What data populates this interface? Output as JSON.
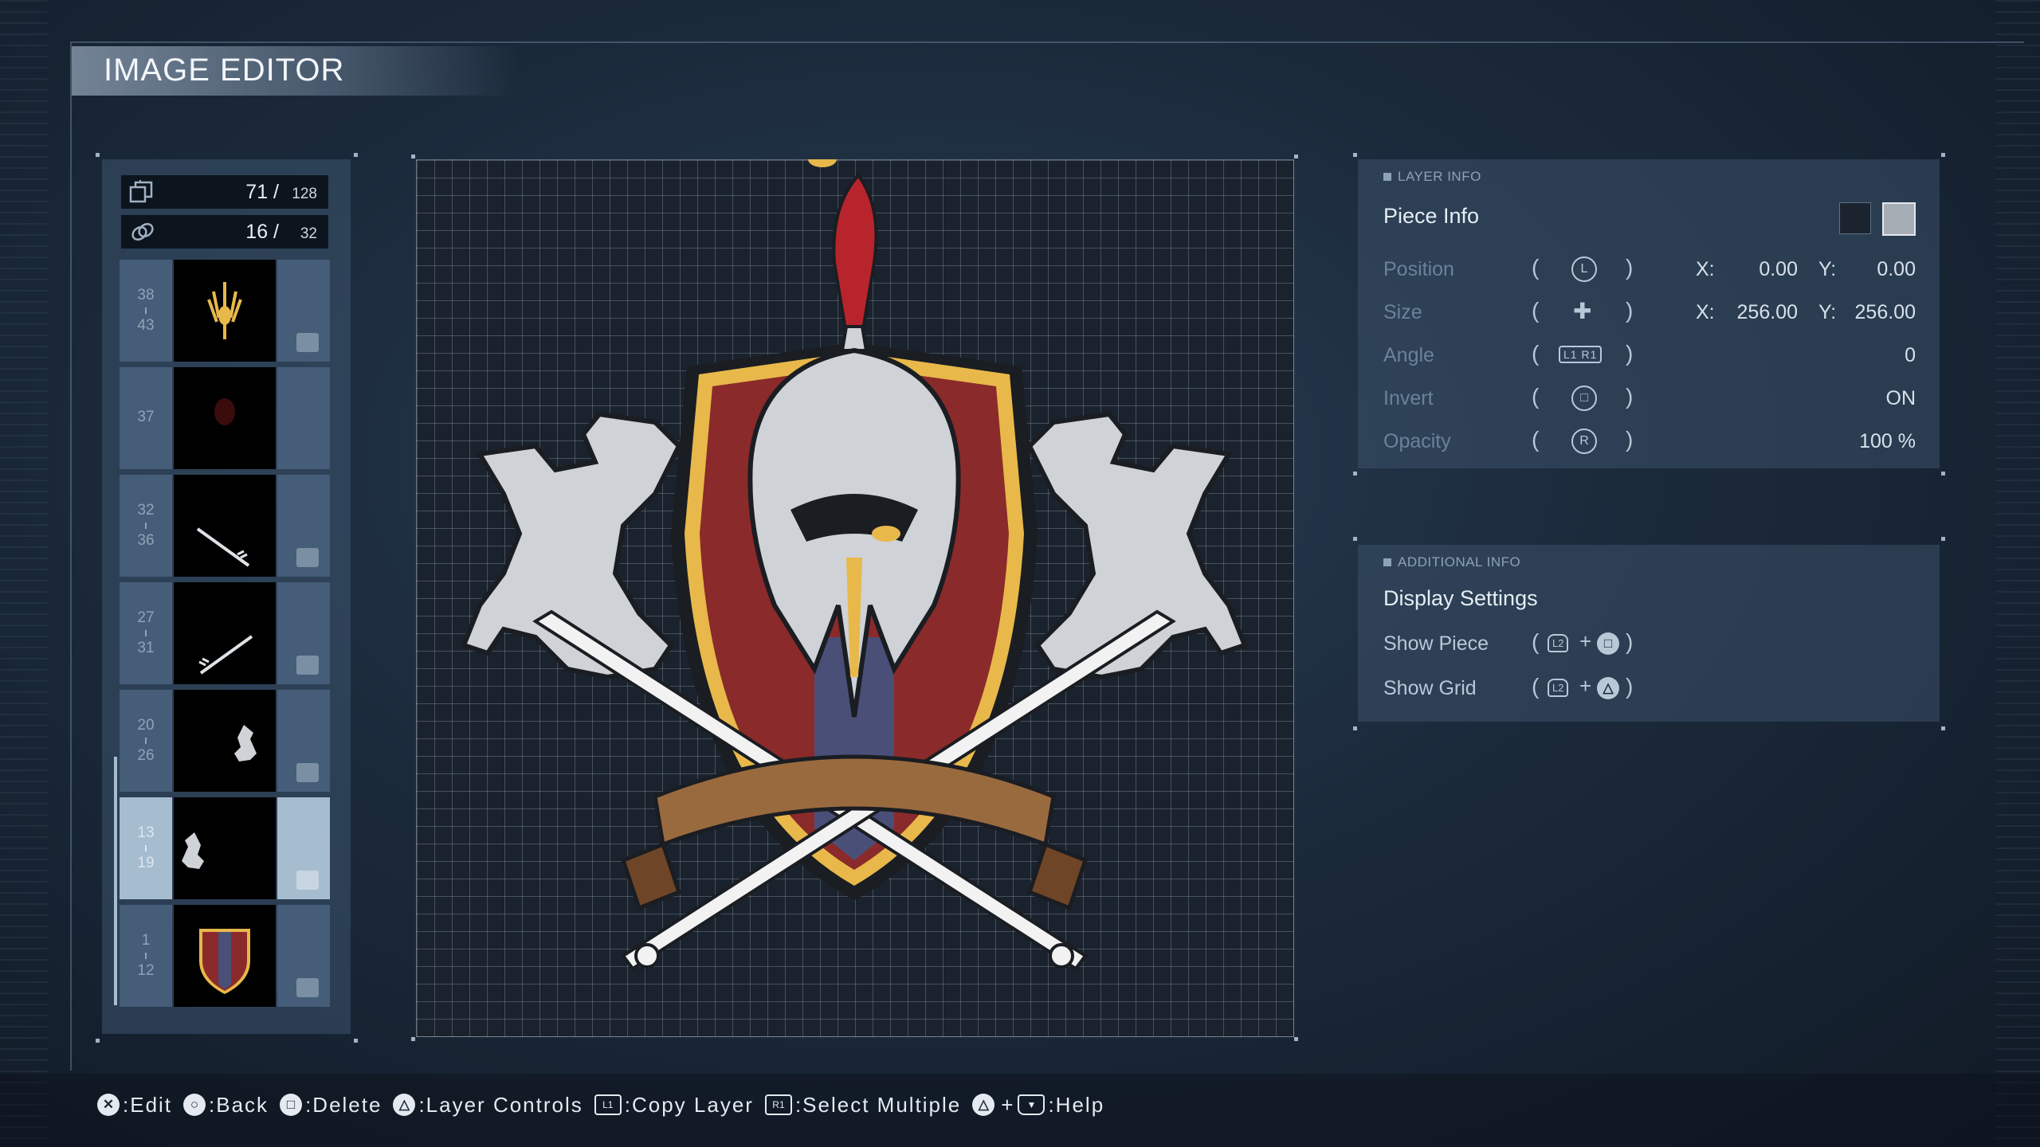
{
  "header": {
    "title": "IMAGE EDITOR"
  },
  "counters": {
    "layers": {
      "value": "71 /",
      "max": "128",
      "icon": "layers-stack-icon"
    },
    "links": {
      "value": "16 /",
      "max": "32",
      "icon": "chain-link-icon"
    }
  },
  "layers": [
    {
      "start": "38",
      "end": "43",
      "thumb": "gold-trident-emblem",
      "linked": true,
      "selected": false
    },
    {
      "start": "37",
      "end": "",
      "thumb": "dark-red-oval",
      "linked": false,
      "selected": false
    },
    {
      "start": "32",
      "end": "36",
      "thumb": "sword-diagonal-down",
      "linked": true,
      "selected": false
    },
    {
      "start": "27",
      "end": "31",
      "thumb": "sword-diagonal-up",
      "linked": true,
      "selected": false
    },
    {
      "start": "20",
      "end": "26",
      "thumb": "white-dragon-right",
      "linked": true,
      "selected": false
    },
    {
      "start": "13",
      "end": "19",
      "thumb": "white-dragon-left",
      "linked": true,
      "selected": true
    },
    {
      "start": "1",
      "end": "12",
      "thumb": "red-shield",
      "linked": true,
      "selected": false
    }
  ],
  "layer_info": {
    "tag": "LAYER INFO",
    "title": "Piece Info",
    "rows": [
      {
        "label": "Position",
        "glyph": "L",
        "x_label": "X:",
        "x": "0.00",
        "y_label": "Y:",
        "y": "0.00"
      },
      {
        "label": "Size",
        "glyph": "✚",
        "x_label": "X:",
        "x": "256.00",
        "y_label": "Y:",
        "y": "256.00"
      },
      {
        "label": "Angle",
        "glyph": "L1 R1",
        "value": "0"
      },
      {
        "label": "Invert",
        "glyph": "□",
        "value": "ON"
      },
      {
        "label": "Opacity",
        "glyph": "R",
        "value": "100 %"
      }
    ]
  },
  "additional_info": {
    "tag": "ADDITIONAL INFO",
    "title": "Display Settings",
    "rows": [
      {
        "label": "Show Piece",
        "glyph_a": "L2",
        "plus": "+",
        "glyph_b": "□"
      },
      {
        "label": "Show Grid",
        "glyph_a": "L2",
        "plus": "+",
        "glyph_b": "△"
      }
    ]
  },
  "help_bar": [
    {
      "glyph": "✕",
      "label": ":Edit"
    },
    {
      "glyph": "○",
      "label": ":Back"
    },
    {
      "glyph": "□",
      "label": ":Delete"
    },
    {
      "glyph": "△",
      "label": ":Layer Controls"
    },
    {
      "glyph": "L1",
      "label": ":Copy Layer",
      "rect": true
    },
    {
      "glyph": "R1",
      "label": ":Select Multiple",
      "rect": true
    },
    {
      "glyph": "△",
      "plus": "+",
      "glyph2": "▼",
      "label": ":Help"
    }
  ],
  "colors": {
    "accent": "#a6bdd0",
    "panel": "#3a5068",
    "emblem_red": "#8b2a2a",
    "emblem_gold": "#e8b84a",
    "emblem_silver": "#cfd2d6",
    "ribbon_brown": "#9a6a3f"
  }
}
